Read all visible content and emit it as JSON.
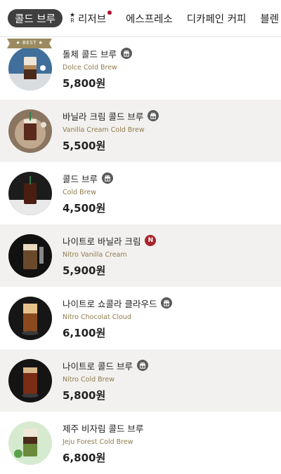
{
  "tabs": [
    {
      "label": "콜드 브루",
      "active": true
    },
    {
      "label": "리저브",
      "has_dot": true
    },
    {
      "label": "에스프레소"
    },
    {
      "label": "디카페인 커피"
    },
    {
      "label": "블렌"
    }
  ],
  "best_badge": "★ BEST ★",
  "items": [
    {
      "name": "돌체 콜드 브루",
      "en": "Dolce Cold Brew",
      "price": "5,800원",
      "badge": "gift-icon"
    },
    {
      "name": "바닐라 크림 콜드 브루",
      "en": "Vanilla Cream Cold Brew",
      "price": "5,500원",
      "badge": "gift-icon"
    },
    {
      "name": "콜드 브루",
      "en": "Cold Brew",
      "price": "4,500원",
      "badge": "gift-icon"
    },
    {
      "name": "나이트로 바닐라 크림",
      "en": "Nitro Vanilla Cream",
      "price": "5,900원",
      "badge": "new-icon",
      "badge_text": "N"
    },
    {
      "name": "나이트로 쇼콜라 클라우드",
      "en": "Nitro Chocolat Cloud",
      "price": "6,100원",
      "badge": "gift-icon"
    },
    {
      "name": "나이트로 콜드 브루",
      "en": "Nitro Cold Brew",
      "price": "5,800원",
      "badge": "gift-icon"
    },
    {
      "name": "제주 비자림 콜드 브루",
      "en": "Jeju Forest Cold Brew",
      "price": "6,800원"
    }
  ],
  "colors": {
    "accent_gold": "#8f7c4e",
    "tab_active_bg": "#3f3f3f",
    "new_badge": "#a8242c"
  }
}
